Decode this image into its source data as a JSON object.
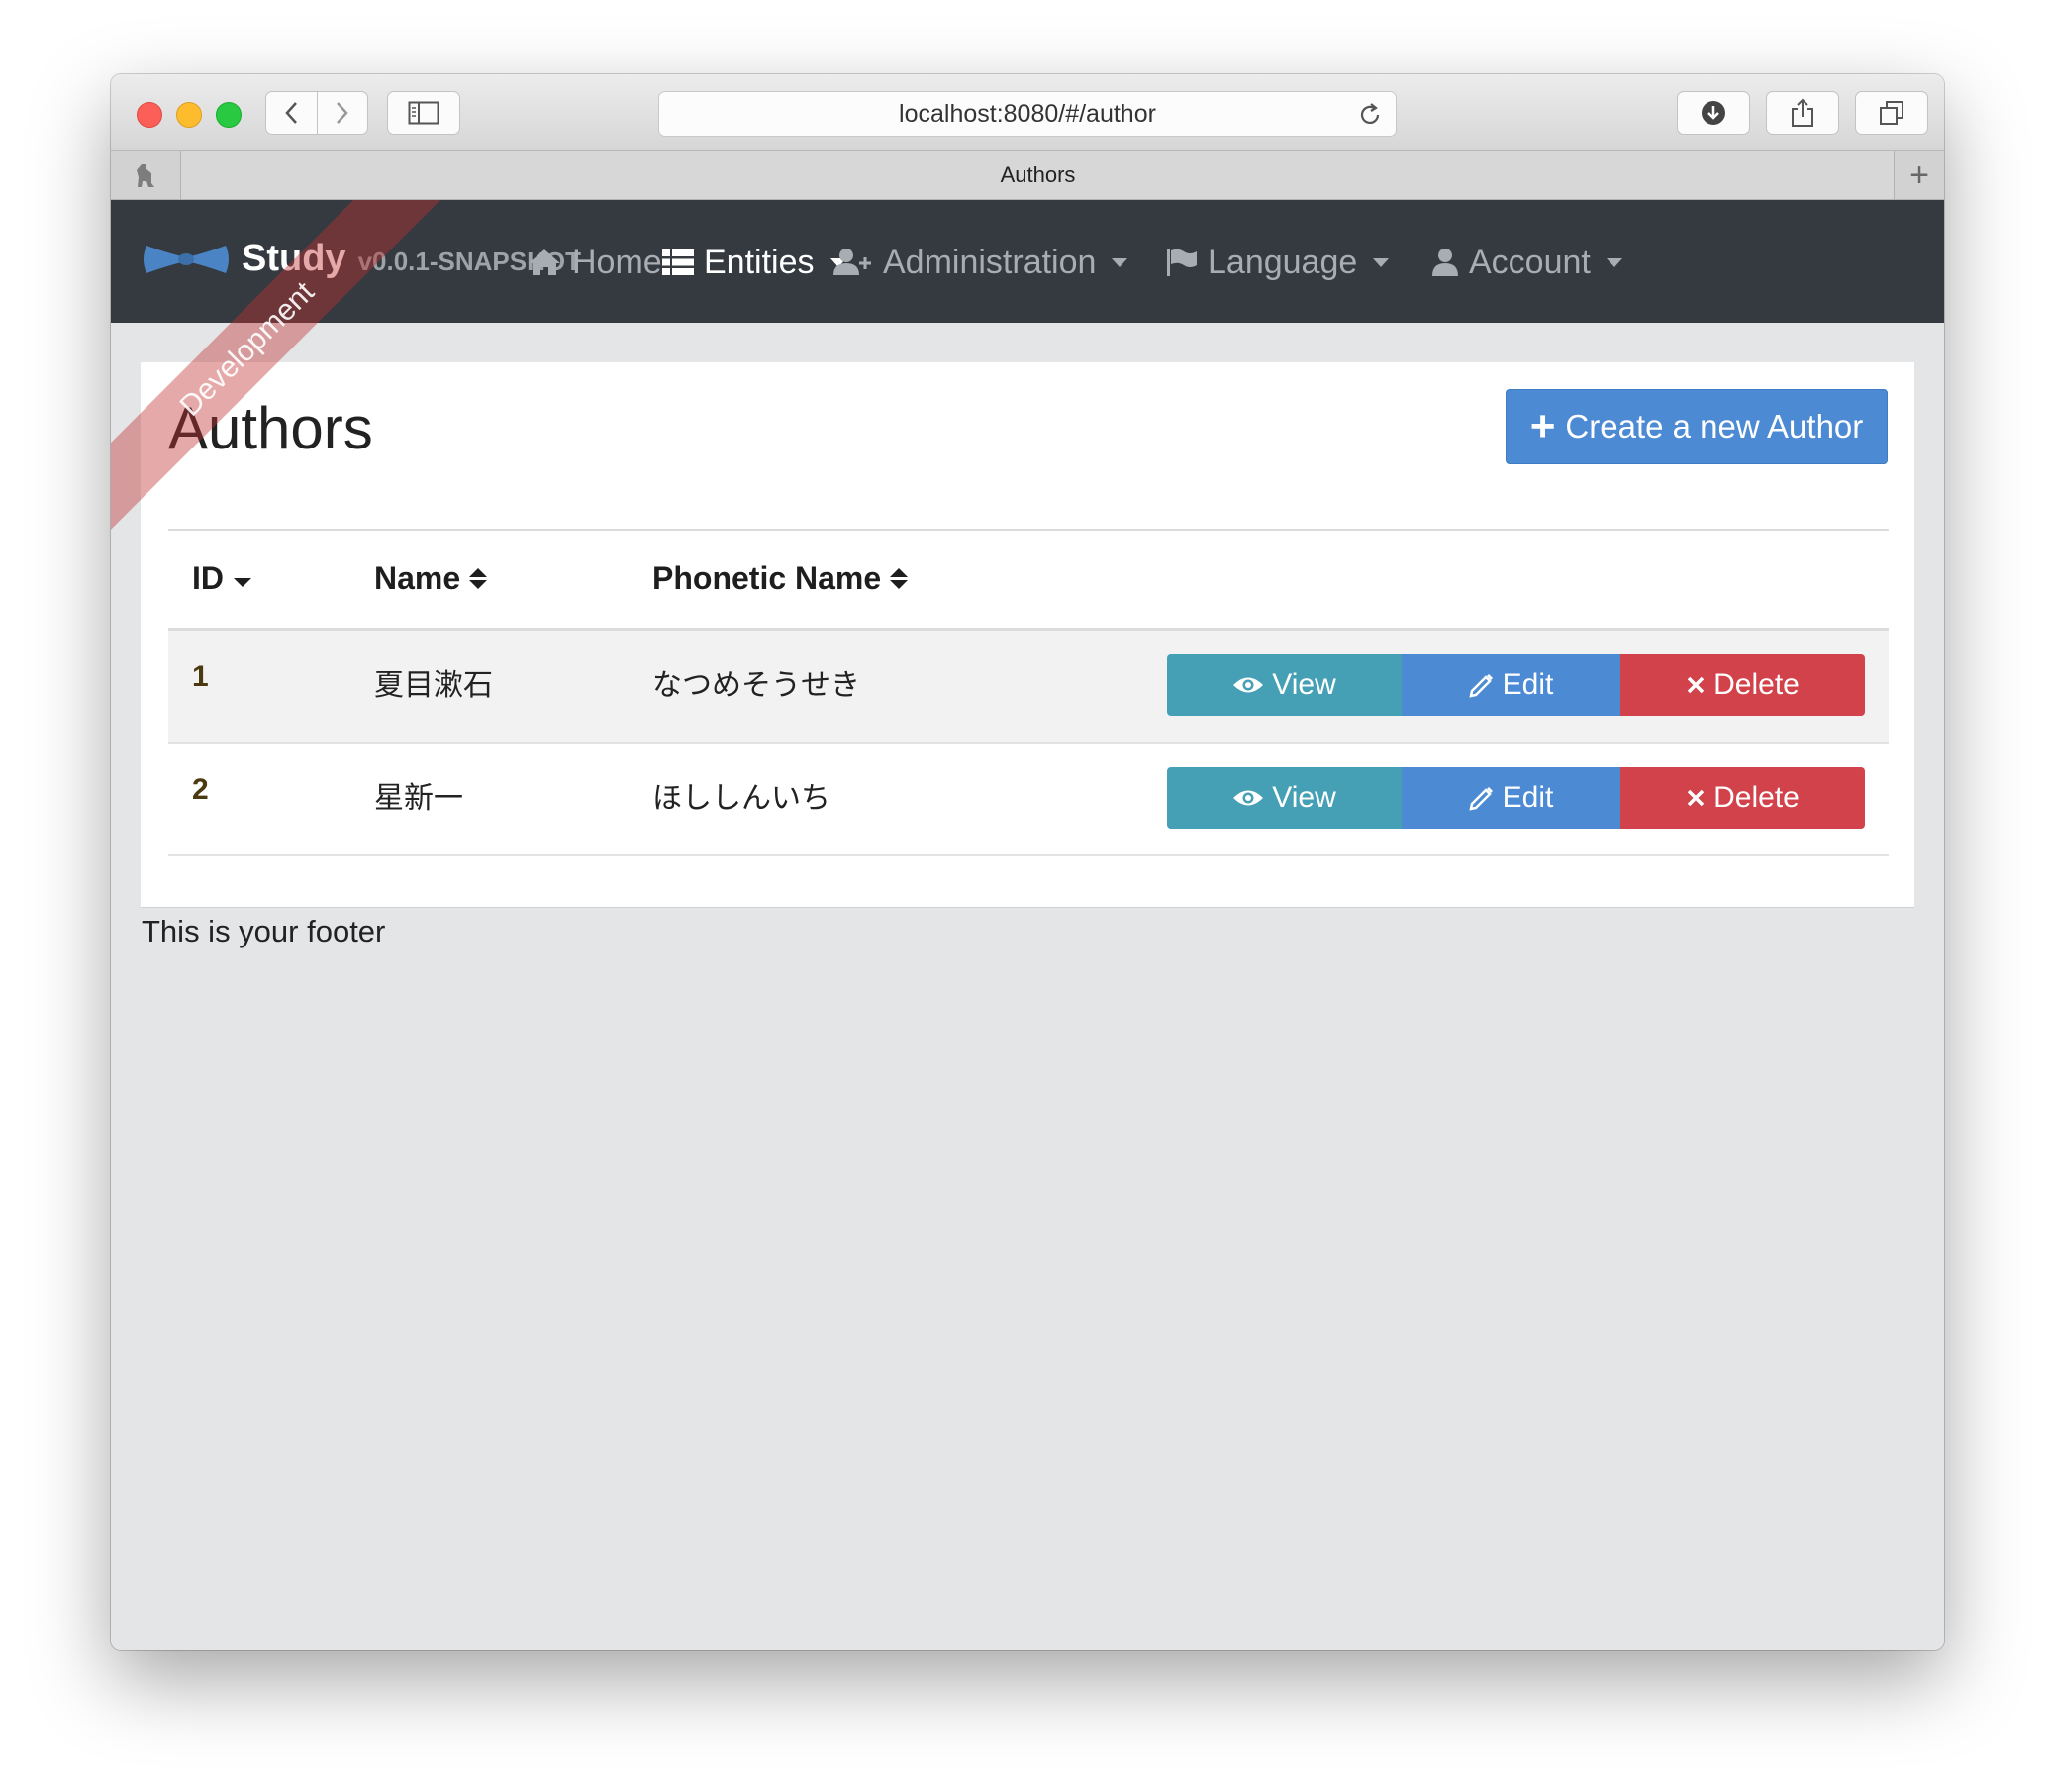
{
  "browser": {
    "url": "localhost:8080/#/author",
    "tab_title": "Authors",
    "buttons": [
      "back",
      "forward",
      "sidebar",
      "downloads",
      "share",
      "tabs"
    ]
  },
  "navbar": {
    "brand_name": "Study",
    "version": "v0.0.1-SNAPSHOT",
    "ribbon": "Development",
    "items": [
      {
        "label": "Home",
        "icon": "home-icon",
        "active": false
      },
      {
        "label": "Entities",
        "icon": "list-icon",
        "active": true
      },
      {
        "label": "Administration",
        "icon": "user-plus-icon",
        "active": false
      },
      {
        "label": "Language",
        "icon": "flag-icon",
        "active": false
      },
      {
        "label": "Account",
        "icon": "user-icon",
        "active": false
      }
    ]
  },
  "page": {
    "title": "Authors",
    "create_button": "Create a new Author"
  },
  "table": {
    "columns": [
      "ID",
      "Name",
      "Phonetic Name"
    ],
    "sort": {
      "ID": "desc",
      "Name": "both",
      "Phonetic Name": "both"
    },
    "rows": [
      {
        "id": "1",
        "name": "夏目漱石",
        "phonetic": "なつめそうせき"
      },
      {
        "id": "2",
        "name": "星新一",
        "phonetic": "ほししんいち"
      }
    ],
    "actions": {
      "view": "View",
      "edit": "Edit",
      "delete": "Delete"
    }
  },
  "footer": "This is your footer",
  "colors": {
    "navbar": "#353a40",
    "primary": "#4c8ad3",
    "info": "#46a0b5",
    "danger": "#d1424b",
    "ribbon": "#c03232"
  }
}
